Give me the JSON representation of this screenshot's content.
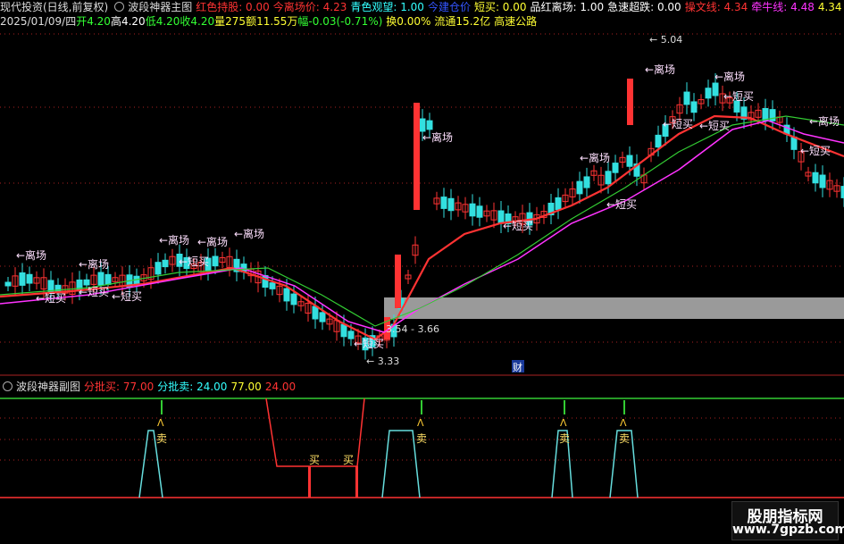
{
  "header": {
    "title": "现代投资(日线,前复权)",
    "indicator": "波段神器主图",
    "items": [
      {
        "label": "红色持股: 0.00",
        "color": "#ff3333"
      },
      {
        "label": "今离场价: 4.23",
        "color": "#ff3333"
      },
      {
        "label": "青色观望: 1.00",
        "color": "#33ffff"
      },
      {
        "label": "今建仓价",
        "color": "#3355ff"
      },
      {
        "label": "短买: 0.00",
        "color": "#ffff33"
      },
      {
        "label": "品红离场: 1.00",
        "color": "#ffffff"
      },
      {
        "label": "急速超跌: 0.00",
        "color": "#ffffff"
      },
      {
        "label": "操文线: 4.34",
        "color": "#ff3333"
      },
      {
        "label": "牵牛线: 4.48",
        "color": "#ff33ff"
      },
      {
        "label": "4.34",
        "color": "#ffff33"
      },
      {
        "label": "4.48",
        "color": "#ff33ff"
      }
    ]
  },
  "quote": {
    "date": "2025/01/09/四",
    "open": "开4.20",
    "high": "高4.20",
    "low": "低4.20",
    "close": "收4.20",
    "volume": "量275",
    "amount": "额11.55万",
    "change": "幅-0.03(-0.71%)",
    "turnover": "换0.00%",
    "float": "流通15.2亿",
    "concept": "高速公路"
  },
  "main_chart": {
    "annotations": {
      "high_label": "5.04",
      "low_label": "3.33",
      "range_label": "3.54 - 3.66",
      "event_marker": "财",
      "exit": "←离场",
      "short_buy": "←短买"
    },
    "colors": {
      "up": "#ff3333",
      "down": "#33e0e0",
      "ma_fast": "#ff3333",
      "ma_mid": "#ff33ff",
      "ma_slow": "#33cc33",
      "grid": "#aa2222"
    }
  },
  "sub_chart": {
    "title": "波段神器副图",
    "items": [
      {
        "label": "分批买: 77.00",
        "color": "#ff3333"
      },
      {
        "label": "分批卖: 24.00",
        "color": "#33ffff"
      },
      {
        "label": "77.00",
        "color": "#ffff33"
      },
      {
        "label": "24.00",
        "color": "#ff3333"
      }
    ],
    "sell": "卖",
    "buy": "买"
  },
  "watermark": {
    "name": "股朋指标网",
    "url": "www.7gpzb.com"
  }
}
